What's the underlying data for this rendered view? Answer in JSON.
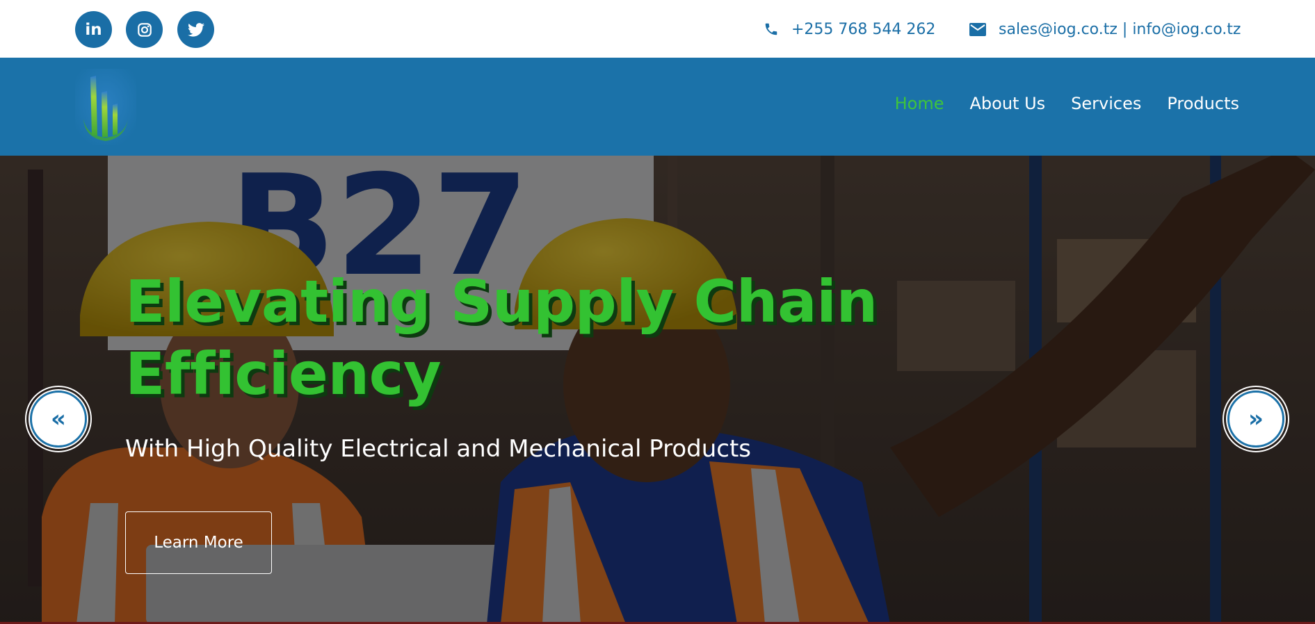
{
  "topbar": {
    "social": [
      {
        "name": "linkedin-icon",
        "label": "in"
      },
      {
        "name": "instagram-icon"
      },
      {
        "name": "twitter-icon"
      }
    ],
    "phone": "+255 768 544 262",
    "email": "sales@iog.co.tz | info@iog.co.tz"
  },
  "nav": {
    "items": [
      {
        "label": "Home",
        "active": true
      },
      {
        "label": "About Us"
      },
      {
        "label": "Services"
      },
      {
        "label": "Products"
      }
    ]
  },
  "hero": {
    "headline_line1": "Elevating Supply Chain",
    "headline_line2": "Efficiency",
    "subheadline": "With High Quality Electrical and Mechanical Products",
    "cta_label": "Learn More",
    "prev_arrow": "«",
    "next_arrow": "»"
  },
  "colors": {
    "brand_blue": "#1b72a9",
    "accent_green": "#33c232",
    "text_blue": "#1a6ea6"
  }
}
